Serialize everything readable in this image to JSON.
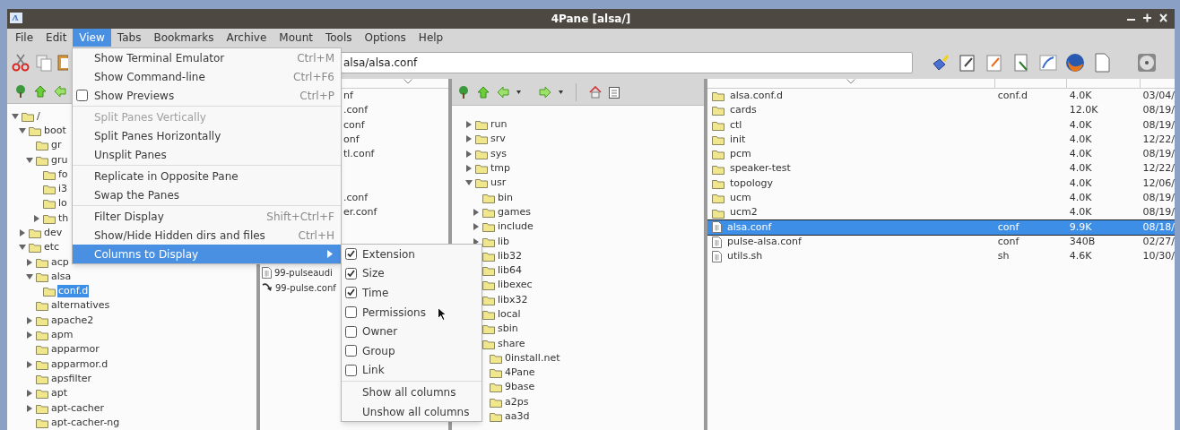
{
  "window": {
    "title": "4Pane [alsa/]"
  },
  "menu_bar": [
    {
      "label": "File",
      "selected": false
    },
    {
      "label": "Edit",
      "selected": false
    },
    {
      "label": "View",
      "selected": true
    },
    {
      "label": "Tabs",
      "selected": false
    },
    {
      "label": "Bookmarks",
      "selected": false
    },
    {
      "label": "Archive",
      "selected": false
    },
    {
      "label": "Mount",
      "selected": false
    },
    {
      "label": "Tools",
      "selected": false
    },
    {
      "label": "Options",
      "selected": false
    },
    {
      "label": "Help",
      "selected": false
    }
  ],
  "toolbar": {
    "location": "alsa/alsa.conf"
  },
  "view_menu": [
    {
      "kind": "item",
      "label": "Show Terminal Emulator",
      "shortcut": "Ctrl+M",
      "disabled": false,
      "selected": false
    },
    {
      "kind": "item",
      "label": "Show Command-line",
      "shortcut": "Ctrl+F6",
      "disabled": false,
      "selected": false
    },
    {
      "kind": "check",
      "label": "Show Previews",
      "shortcut": "Ctrl+P",
      "checked": false,
      "disabled": false,
      "selected": false
    },
    {
      "kind": "separator"
    },
    {
      "kind": "item",
      "label": "Split Panes Vertically",
      "disabled": true,
      "selected": false
    },
    {
      "kind": "item",
      "label": "Split Panes Horizontally",
      "disabled": false,
      "selected": false
    },
    {
      "kind": "item",
      "label": "Unsplit Panes",
      "disabled": false,
      "selected": false
    },
    {
      "kind": "separator"
    },
    {
      "kind": "item",
      "label": "Replicate in Opposite Pane",
      "disabled": false,
      "selected": false
    },
    {
      "kind": "item",
      "label": "Swap the Panes",
      "disabled": false,
      "selected": false
    },
    {
      "kind": "separator"
    },
    {
      "kind": "item",
      "label": "Filter Display",
      "shortcut": "Shift+Ctrl+F",
      "disabled": false,
      "selected": false
    },
    {
      "kind": "item",
      "label": "Show/Hide Hidden dirs and files",
      "shortcut": "Ctrl+H",
      "disabled": false,
      "selected": false
    },
    {
      "kind": "submenu",
      "label": "Columns to Display",
      "disabled": false,
      "selected": true
    }
  ],
  "columns_submenu": [
    {
      "kind": "check",
      "label": "Extension",
      "checked": true
    },
    {
      "kind": "check",
      "label": "Size",
      "checked": true
    },
    {
      "kind": "check",
      "label": "Time",
      "checked": true
    },
    {
      "kind": "check",
      "label": "Permissions",
      "checked": false
    },
    {
      "kind": "check",
      "label": "Owner",
      "checked": false
    },
    {
      "kind": "check",
      "label": "Group",
      "checked": false
    },
    {
      "kind": "check",
      "label": "Link",
      "checked": false
    },
    {
      "kind": "separator"
    },
    {
      "kind": "item",
      "label": "Show all columns"
    },
    {
      "kind": "item",
      "label": "Unshow all columns"
    }
  ],
  "left_tree": [
    {
      "label": "/",
      "expanded": true,
      "selected": false,
      "children": [
        {
          "label": "boot",
          "expanded": true,
          "selected": false,
          "children": [
            {
              "label": "gr",
              "selected": false
            },
            {
              "label": "gru",
              "expanded": true,
              "selected": false,
              "children": [
                {
                  "label": "fo",
                  "selected": false
                },
                {
                  "label": "i3",
                  "selected": false
                },
                {
                  "label": "lo",
                  "selected": false
                },
                {
                  "label": "th",
                  "expanded": false,
                  "selected": false
                }
              ]
            }
          ]
        },
        {
          "label": "dev",
          "expanded": false,
          "selected": false
        },
        {
          "label": "etc",
          "expanded": true,
          "selected": false,
          "children": [
            {
              "label": "acp",
              "expanded": false,
              "selected": false
            },
            {
              "label": "alsa",
              "expanded": true,
              "selected": false,
              "children": [
                {
                  "label": "conf.d",
                  "selected": true
                }
              ]
            },
            {
              "label": "alternatives",
              "selected": false
            },
            {
              "label": "apache2",
              "expanded": false,
              "selected": false
            },
            {
              "label": "apm",
              "expanded": false,
              "selected": false
            },
            {
              "label": "apparmor",
              "selected": false
            },
            {
              "label": "apparmor.d",
              "expanded": false,
              "selected": false
            },
            {
              "label": "apsfilter",
              "selected": false
            },
            {
              "label": "apt",
              "expanded": false,
              "selected": false
            },
            {
              "label": "apt-cacher",
              "expanded": false,
              "selected": false
            },
            {
              "label": "apt-cacher-ng",
              "selected": false
            }
          ]
        }
      ]
    }
  ],
  "middle_pane": {
    "fragment_groups": [
      [
        "nf",
        ".conf",
        "conf",
        "onf",
        "tl.conf"
      ],
      [
        ".conf",
        "er.conf"
      ]
    ],
    "files": [
      {
        "kind": "file",
        "name": "99-pulseaudi",
        "selected": false
      },
      {
        "kind": "symlink",
        "name": "99-pulse.conf",
        "selected": false
      }
    ]
  },
  "right_tree": [
    {
      "label": "run",
      "expanded": false,
      "selected": false
    },
    {
      "label": "srv",
      "expanded": false,
      "selected": false
    },
    {
      "label": "sys",
      "expanded": false,
      "selected": false
    },
    {
      "label": "tmp",
      "expanded": false,
      "selected": false
    },
    {
      "label": "usr",
      "expanded": true,
      "selected": false,
      "children": [
        {
          "label": "bin",
          "selected": false
        },
        {
          "label": "games",
          "expanded": false,
          "selected": false
        },
        {
          "label": "include",
          "expanded": false,
          "selected": false
        },
        {
          "label": "lib",
          "expanded": false,
          "selected": false
        },
        {
          "label": "lib32",
          "selected": false
        },
        {
          "label": "lib64",
          "selected": false
        },
        {
          "label": "libexec",
          "selected": false
        },
        {
          "label": "libx32",
          "selected": false
        },
        {
          "label": "local",
          "selected": false
        },
        {
          "label": "sbin",
          "selected": false
        },
        {
          "label": "share",
          "selected": false,
          "children": [
            {
              "label": "0install.net",
              "selected": false
            },
            {
              "label": "4Pane",
              "selected": false
            },
            {
              "label": "9base",
              "selected": false
            },
            {
              "label": "a2ps",
              "selected": false
            },
            {
              "label": "aa3d",
              "selected": false
            }
          ]
        }
      ]
    }
  ],
  "file_list": [
    {
      "kind": "folder",
      "name": "alsa.conf.d",
      "ext": "conf.d",
      "size": "4.0K",
      "date": "03/04/",
      "selected": false
    },
    {
      "kind": "folder",
      "name": "cards",
      "size": "12.0K",
      "date": "08/19/",
      "selected": false
    },
    {
      "kind": "folder",
      "name": "ctl",
      "size": "4.0K",
      "date": "08/19/",
      "selected": false
    },
    {
      "kind": "folder",
      "name": "init",
      "size": "4.0K",
      "date": "12/22/",
      "selected": false
    },
    {
      "kind": "folder",
      "name": "pcm",
      "size": "4.0K",
      "date": "08/19/",
      "selected": false
    },
    {
      "kind": "folder",
      "name": "speaker-test",
      "size": "4.0K",
      "date": "12/22/",
      "selected": false
    },
    {
      "kind": "folder",
      "name": "topology",
      "size": "4.0K",
      "date": "12/06/",
      "selected": false
    },
    {
      "kind": "folder",
      "name": "ucm",
      "size": "4.0K",
      "date": "08/19/",
      "selected": false
    },
    {
      "kind": "folder",
      "name": "ucm2",
      "size": "4.0K",
      "date": "08/19/",
      "selected": false
    },
    {
      "kind": "file",
      "name": "alsa.conf",
      "ext": "conf",
      "size": "9.9K",
      "date": "08/18/",
      "selected": true
    },
    {
      "kind": "file",
      "name": "pulse-alsa.conf",
      "ext": "conf",
      "size": "340B",
      "date": "02/27/",
      "selected": false
    },
    {
      "kind": "file",
      "name": "utils.sh",
      "ext": "sh",
      "size": "4.6K",
      "date": "10/30/",
      "selected": false
    }
  ]
}
